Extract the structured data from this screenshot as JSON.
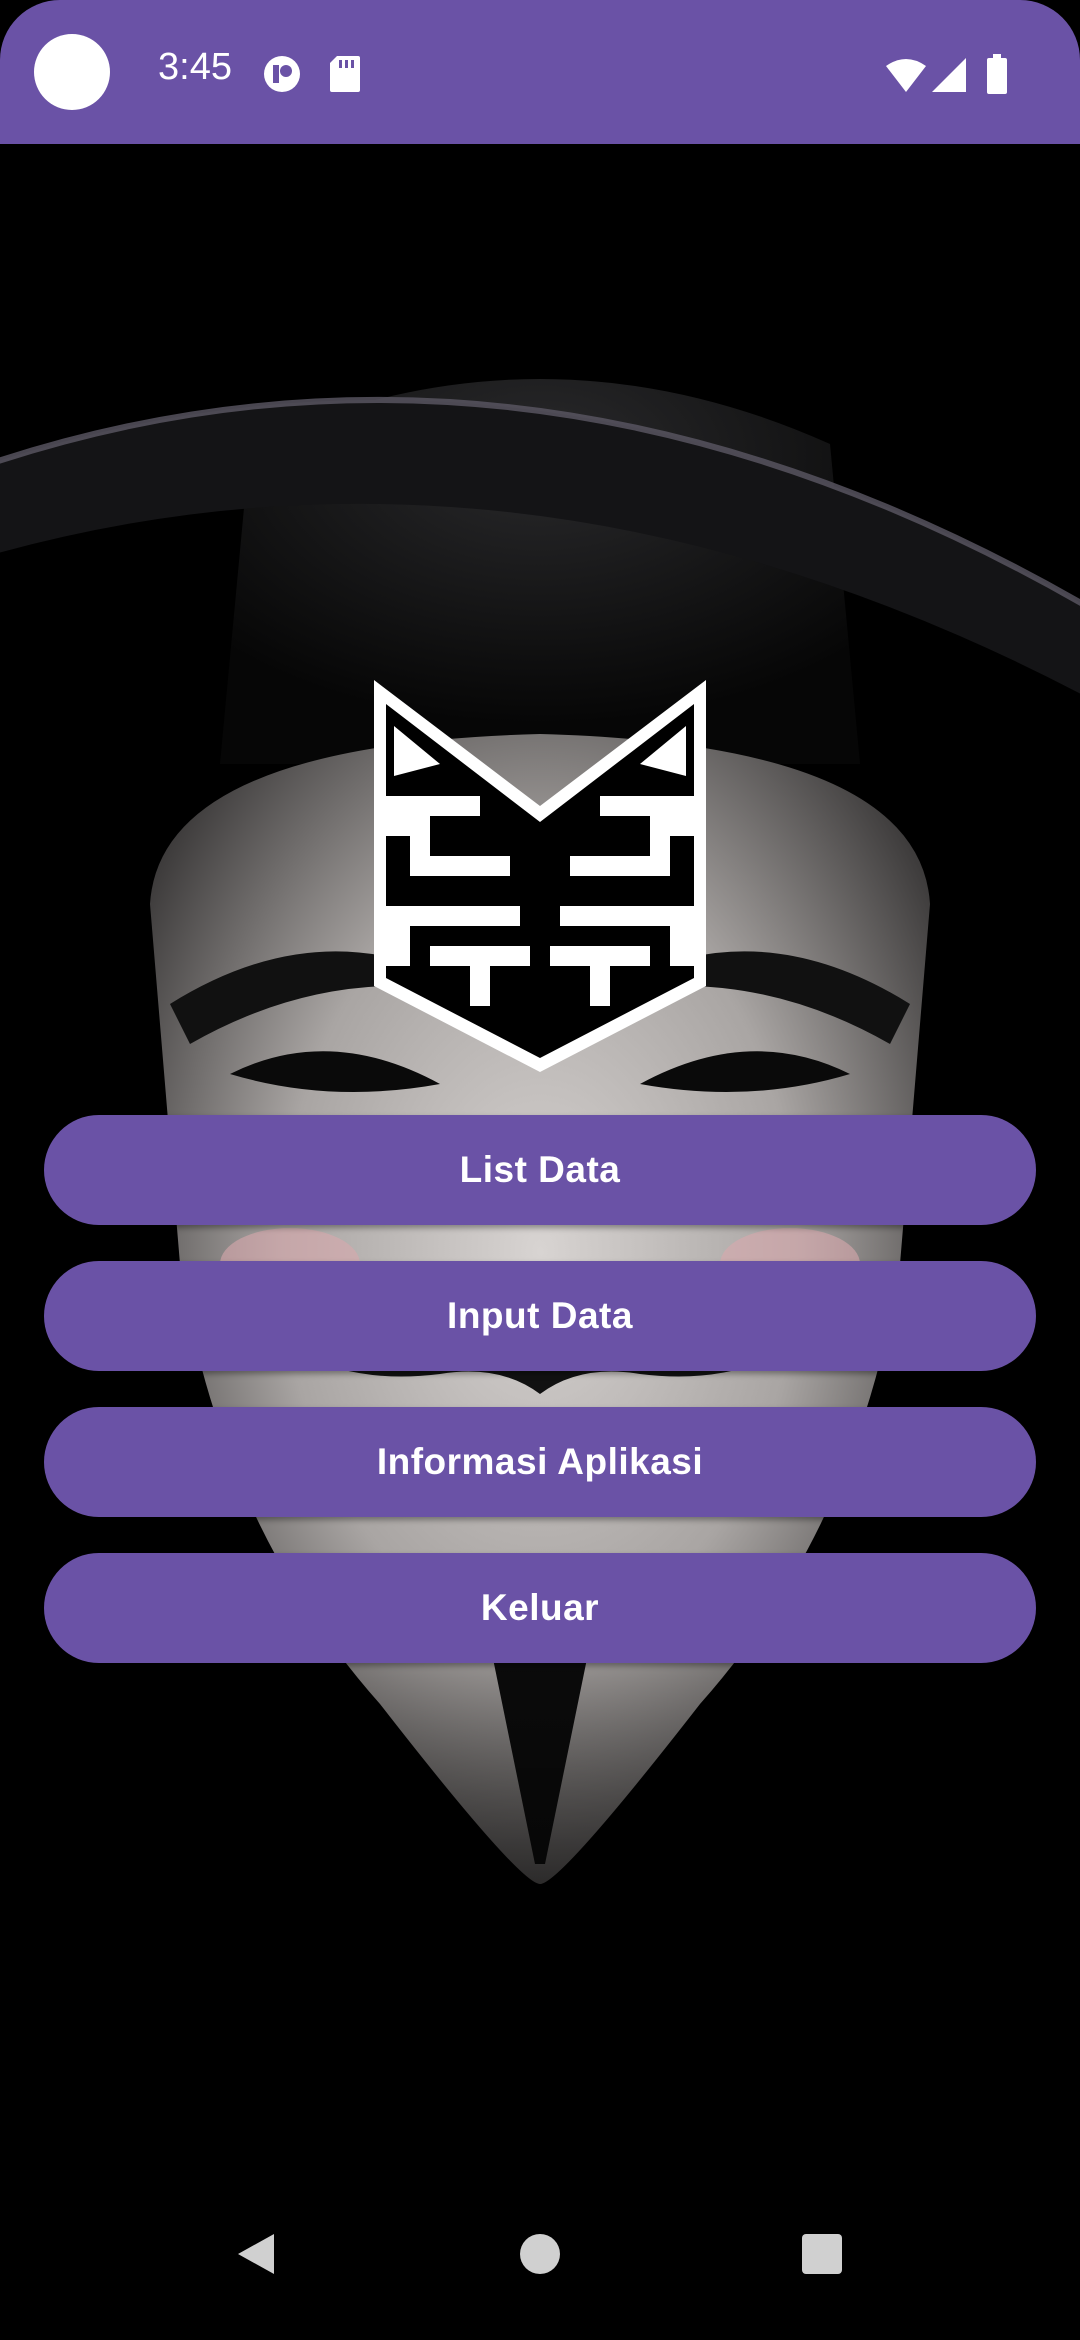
{
  "status_bar": {
    "time": "3:45",
    "icons": [
      "notification-dot-icon",
      "app-indicator-icon",
      "sd-card-icon",
      "wifi-icon",
      "signal-icon",
      "battery-icon"
    ],
    "background_color": "#6a52a6"
  },
  "background": {
    "description_icon": "guy-fawkes-mask-art"
  },
  "logo": {
    "icon": "fox-emblem-logo"
  },
  "menu": {
    "buttons": [
      {
        "label": "List Data"
      },
      {
        "label": "Input Data"
      },
      {
        "label": "Informasi Aplikasi"
      },
      {
        "label": "Keluar"
      }
    ],
    "button_color": "#6a52a6"
  },
  "nav_bar": {
    "items": [
      "back-icon",
      "home-icon",
      "recents-icon"
    ]
  }
}
